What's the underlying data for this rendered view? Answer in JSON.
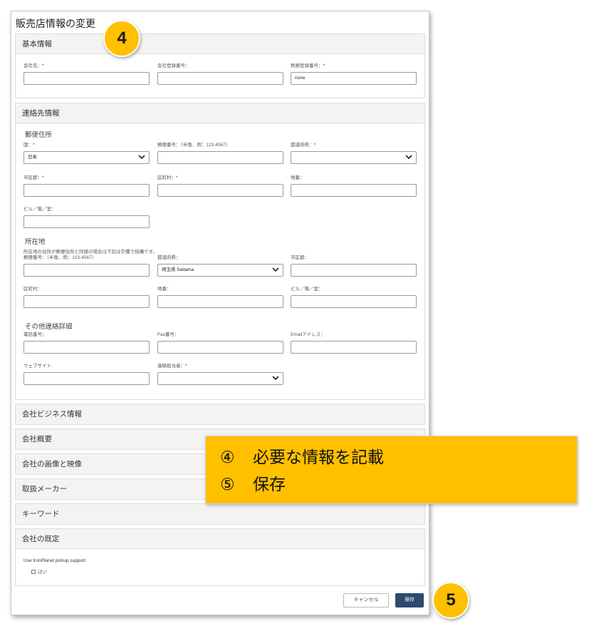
{
  "page": {
    "title": "販売店情報の変更"
  },
  "basic": {
    "header": "基本情報",
    "fields": [
      {
        "label": "会社名：",
        "required": "*",
        "value": ""
      },
      {
        "label": "会社登録番号：",
        "required": "",
        "value": ""
      },
      {
        "label": "税務登録番号：",
        "required": "*",
        "value": "none"
      }
    ]
  },
  "contact": {
    "header": "連絡先情報",
    "postal": {
      "title": "郵便住所",
      "fields": [
        {
          "label": "国：",
          "required": "*",
          "value": "日本"
        },
        {
          "label": "郵便番号：（半角、例：123-4567）",
          "required": "",
          "value": ""
        },
        {
          "label": "都道府県：",
          "required": "*",
          "value": ""
        },
        {
          "label": "市区郡：",
          "required": "*",
          "value": ""
        },
        {
          "label": "区町村：",
          "required": "*",
          "value": ""
        },
        {
          "label": "地番：",
          "required": "",
          "value": ""
        },
        {
          "label": "ビル／階／室：",
          "required": "",
          "value": ""
        }
      ]
    },
    "location": {
      "title": "所在地",
      "note": "所在地の住所が郵便住所と同様の場合は下記は空欄で結構です。",
      "fields": [
        {
          "label": "郵便番号：（半角、例：123-4567）",
          "required": "",
          "value": ""
        },
        {
          "label": "都道府県：",
          "required": "",
          "value": "埼玉県 Saitama"
        },
        {
          "label": "市区郡：",
          "required": "",
          "value": ""
        },
        {
          "label": "区町村：",
          "required": "",
          "value": ""
        },
        {
          "label": "地番：",
          "required": "",
          "value": ""
        },
        {
          "label": "ビル／階／室：",
          "required": "",
          "value": ""
        }
      ]
    },
    "other": {
      "title": "その他連絡詳細",
      "fields": [
        {
          "label": "電話番号：",
          "required": "",
          "value": ""
        },
        {
          "label": "Fax番号：",
          "required": "",
          "value": ""
        },
        {
          "label": "Emailアドレス：",
          "required": "",
          "value": ""
        },
        {
          "label": "ウェブサイト:",
          "required": "",
          "value": ""
        },
        {
          "label": "連絡担当者：",
          "required": "*",
          "value": ""
        }
      ]
    }
  },
  "sections": [
    {
      "label": "会社ビジネス情報"
    },
    {
      "label": "会社概要"
    },
    {
      "label": "会社の画像と映像"
    },
    {
      "label": "取扱メーカー"
    },
    {
      "label": "キーワード"
    }
  ],
  "defaults": {
    "header": "会社の既定",
    "pickup_label": "Use IronPlanet pickup support",
    "pickup_option": "はい"
  },
  "buttons": {
    "cancel": "キャンセル",
    "save": "保存"
  },
  "callout": {
    "line1_num": "④",
    "line1_text": "必要な情報を記載",
    "line2_num": "⑤",
    "line2_text": "保存"
  },
  "badges": {
    "step4": "4",
    "step5": "5"
  },
  "colors": {
    "accent": "#ffc000",
    "save_button": "#2c4a6e",
    "required": "#d0021b"
  },
  "icons": {
    "dropdown": "chevron-down-icon",
    "checkbox": "checkbox-icon"
  }
}
